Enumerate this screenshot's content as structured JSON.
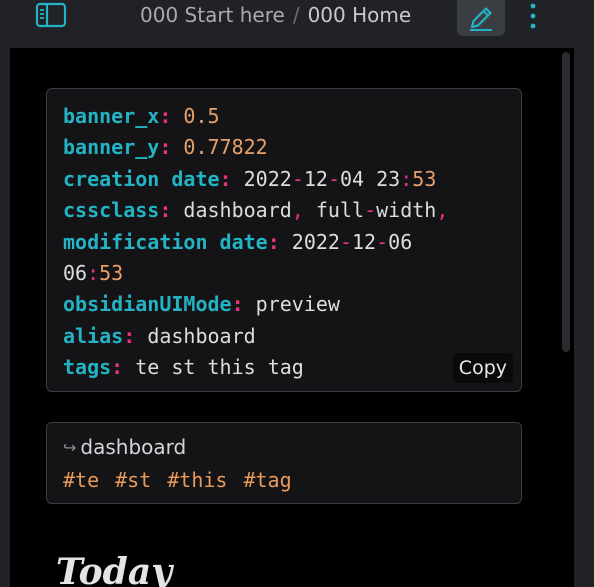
{
  "header": {
    "breadcrumb": [
      "000 Start here",
      "000 Home"
    ],
    "separator": "/",
    "icons": {
      "sidebar_toggle": "sidebar-icon",
      "edit": "pencil-icon",
      "more": "more-vertical-icon"
    },
    "accent": "#23b3c4"
  },
  "frontmatter": {
    "banner_x": {
      "key": "banner_x",
      "value": "0.5"
    },
    "banner_y": {
      "key": "banner_y",
      "value": "0.77822"
    },
    "creation_date": {
      "key": "creation date",
      "date": "2022",
      "d1": "12",
      "d2": "04",
      "time_h": "23",
      "time_m": "53"
    },
    "cssclass": {
      "key": "cssclass",
      "v1": "dashboard",
      "v2a": "full",
      "v2b": "width"
    },
    "modification_date": {
      "key": "modification date",
      "date": "2022",
      "d1": "12",
      "d2": "06",
      "time_h": "06",
      "time_m": "53"
    },
    "obsidianUIMode": {
      "key": "obsidianUIMode",
      "value": "preview"
    },
    "alias": {
      "key": "alias",
      "value": "dashboard"
    },
    "tags": {
      "key": "tags",
      "value": "te st this tag"
    },
    "copy_label": "Copy",
    "colors": {
      "key": "#23b3c4",
      "punct": "#e7337b",
      "number": "#e8a06a",
      "text": "#dcddde"
    }
  },
  "metadata": {
    "alias": "dashboard",
    "alias_icon": "redirect-arrow-icon",
    "tags": [
      "#te",
      "#st",
      "#this",
      "#tag"
    ],
    "tag_color": "#e89a5c"
  },
  "content": {
    "heading": "Today"
  }
}
